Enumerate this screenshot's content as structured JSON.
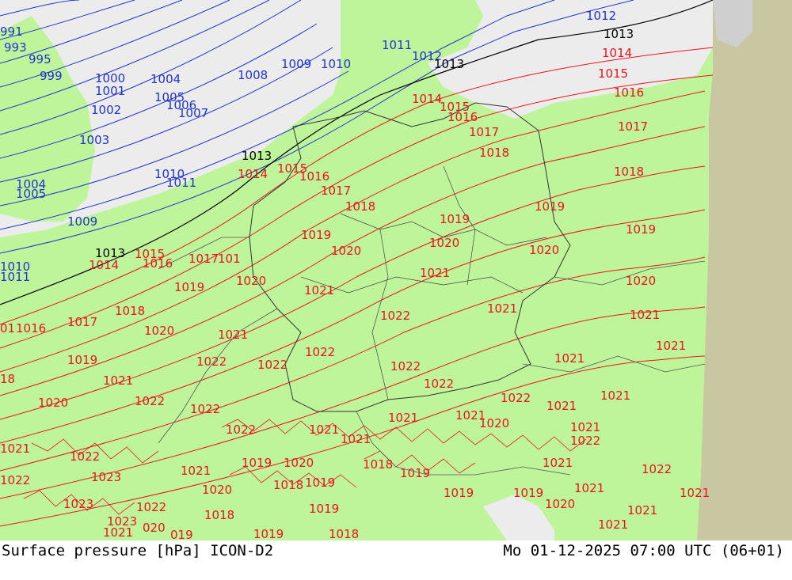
{
  "footer": {
    "left": "Surface pressure [hPa] ICON-D2",
    "right": "Mo 01-12-2025 07:00 UTC (06+01)"
  },
  "colors": {
    "land": "#bff59a",
    "sea": "#ececec",
    "outside_domain": "#c9c6a2",
    "isobar_low": "#2233cc",
    "isobar_mid": "#000000",
    "isobar_high": "#e8141c",
    "border": "#333333"
  },
  "isobar_labels": {
    "blue": [
      "991",
      "993",
      "995",
      "999",
      "1000",
      "1001",
      "1002",
      "1003",
      "1004",
      "1005",
      "1006",
      "1007",
      "1008",
      "1009",
      "1010",
      "1011",
      "1012"
    ],
    "black": [
      "1013"
    ],
    "red": [
      "1014",
      "1015",
      "1016",
      "1017",
      "1018",
      "1019",
      "1020",
      "1021",
      "1022",
      "1023"
    ]
  }
}
